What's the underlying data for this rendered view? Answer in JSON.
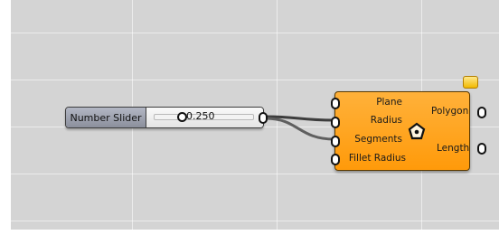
{
  "canvas": {
    "background": "#d4d4d4",
    "grid_color": "#e6e6e6"
  },
  "slider": {
    "name": "Number Slider",
    "value": "0.250",
    "name_bg": "#9a9eab"
  },
  "component": {
    "accent": "#ffa31a",
    "icon": "polygon-icon",
    "inputs": [
      "Plane",
      "Radius",
      "Segments",
      "Fillet Radius"
    ],
    "outputs": [
      "Polygon",
      "Length"
    ],
    "badge": "warning-badge"
  }
}
